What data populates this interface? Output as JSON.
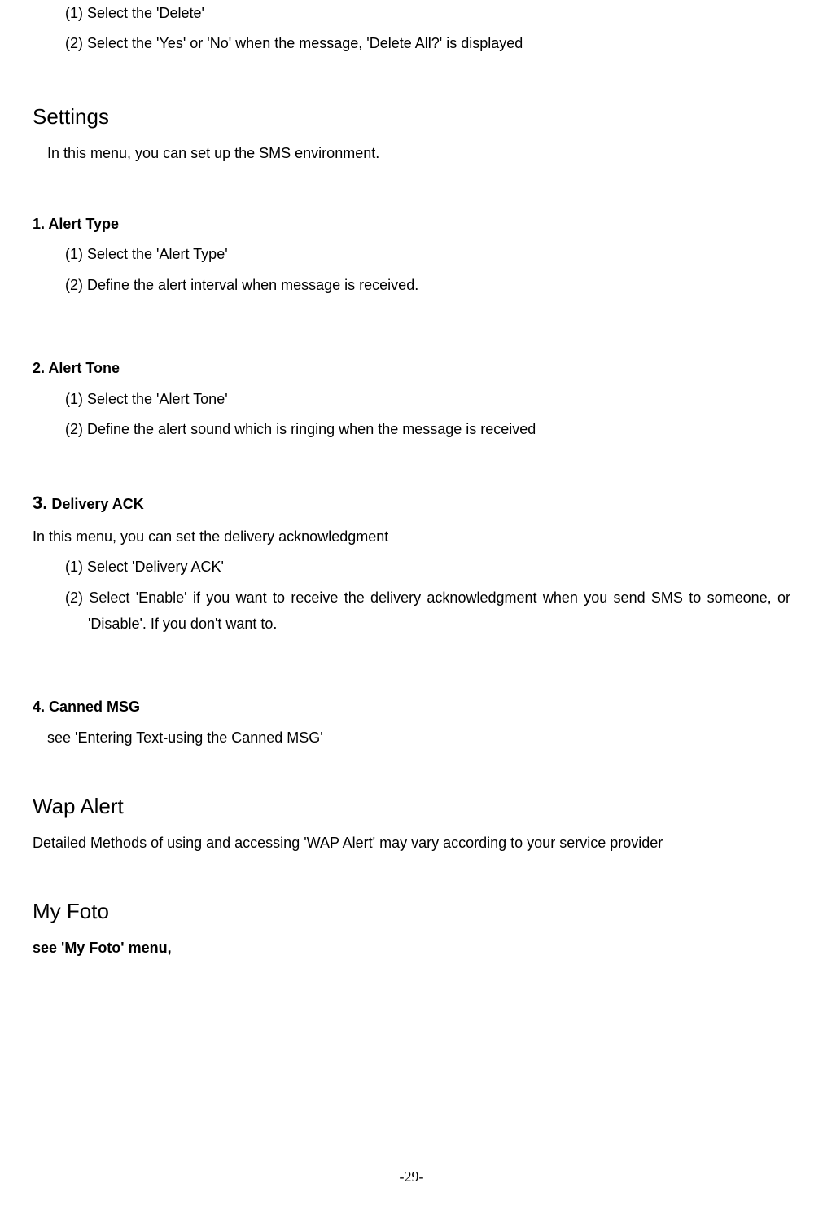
{
  "intro": {
    "step1": "(1) Select the 'Delete'",
    "step2": "(2) Select the 'Yes' or 'No' when the message, 'Delete All?' is displayed"
  },
  "settings": {
    "title": "Settings",
    "desc": "In this menu, you can set up the SMS environment."
  },
  "alertType": {
    "heading": "1. Alert Type",
    "step1": "(1) Select the   'Alert Type'",
    "step2": "(2) Define the alert interval when message is received."
  },
  "alertTone": {
    "heading": "2. Alert Tone",
    "step1": "(1) Select the 'Alert Tone'",
    "step2": "(2) Define the alert sound which is ringing when the message is received"
  },
  "deliveryAck": {
    "num": "3.",
    "rest": " Delivery ACK",
    "desc": "In this menu, you can set the delivery acknowledgment",
    "step1": "(1) Select 'Delivery ACK'",
    "step2": "(2) Select 'Enable' if you want to receive the delivery acknowledgment when you send SMS to someone,   or 'Disable'. If you don't want to."
  },
  "cannedMsg": {
    "heading": "4. Canned MSG",
    "desc": "see 'Entering Text-using the Canned MSG'"
  },
  "wapAlert": {
    "title": "Wap Alert",
    "desc": "Detailed Methods of using and accessing 'WAP Alert' may vary according to your service provider"
  },
  "myFoto": {
    "title": "My Foto",
    "desc": "see 'My Foto' menu,"
  },
  "pageNumber": "-29-"
}
